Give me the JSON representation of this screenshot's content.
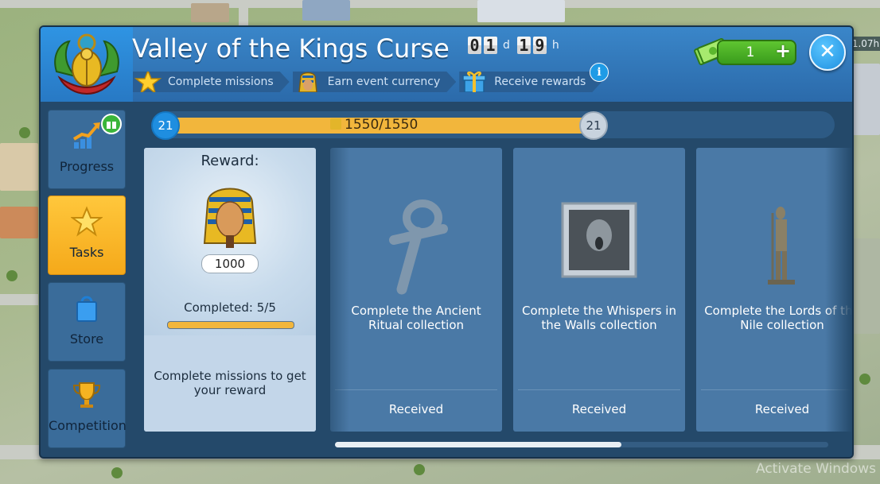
{
  "header": {
    "title": "Valley of the Kings Curse",
    "timer": {
      "days": [
        "0",
        "1"
      ],
      "day_unit": "d",
      "hours": [
        "1",
        "9"
      ],
      "hour_unit": "h"
    },
    "steps": [
      {
        "label": "Complete missions",
        "icon": "star-icon"
      },
      {
        "label": "Earn event currency",
        "icon": "pharaoh-coin-icon"
      },
      {
        "label": "Receive rewards",
        "icon": "gift-icon"
      }
    ],
    "info": "i",
    "currency": {
      "value": "1",
      "plus": "+"
    },
    "close": "✕"
  },
  "sidebar": {
    "items": [
      {
        "label": "Progress",
        "icon": "progress-chart-icon"
      },
      {
        "label": "Tasks",
        "icon": "star-icon",
        "active": true
      },
      {
        "label": "Store",
        "icon": "shopping-bag-icon"
      },
      {
        "label": "Competition",
        "icon": "trophy-icon"
      }
    ]
  },
  "progress": {
    "level_left": "21",
    "level_right": "21",
    "text": "1550/1550",
    "current": 1550,
    "max": 1550
  },
  "reward": {
    "title": "Reward:",
    "amount": "1000",
    "completed": "Completed: 5/5",
    "message": "Complete missions to get your reward"
  },
  "missions": [
    {
      "text": "Complete the Ancient Ritual collection",
      "status": "Received",
      "icon": "ankh-icon"
    },
    {
      "text": "Complete the Whispers in the Walls collection",
      "status": "Received",
      "icon": "ghost-frame-icon"
    },
    {
      "text": "Complete the Lords of the Nile collection",
      "status": "Received",
      "icon": "egyptian-statue-icon"
    }
  ],
  "background": {
    "badge": "1.07h",
    "watermark": "Activate Windows"
  },
  "colors": {
    "accent": "#f2b63c",
    "panel": "#24496a",
    "header": "#2b6aaa",
    "active_tab": "#ffc73c",
    "card": "#4a79a6"
  }
}
